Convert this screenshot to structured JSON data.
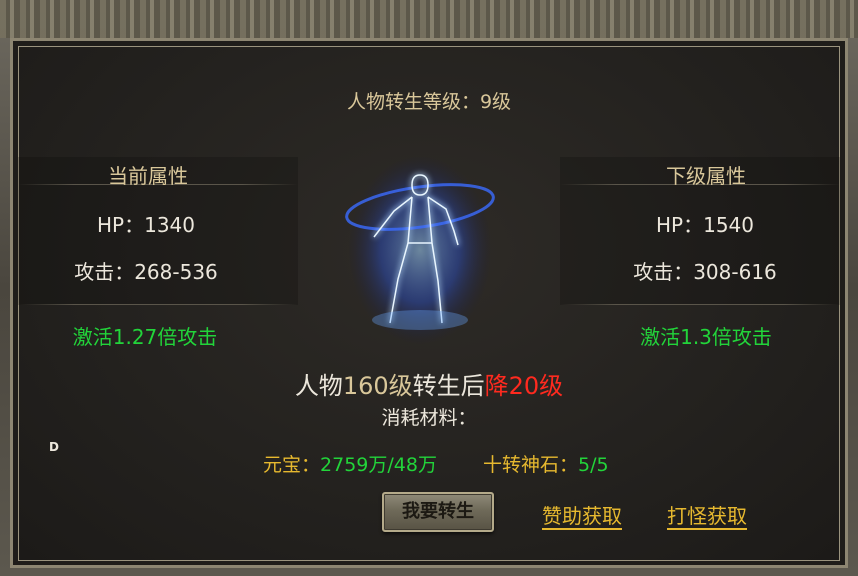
{
  "title": "人物转生等级：9级",
  "current": {
    "header": "当前属性",
    "hp": "HP：1340",
    "attack": "攻击：268-536",
    "activation": "激活1.27倍攻击"
  },
  "next": {
    "header": "下级属性",
    "hp": "HP：1540",
    "attack": "攻击：308-616",
    "activation": "激活1.3倍攻击"
  },
  "notice": {
    "prefix": "人物",
    "level": "160级",
    "middle": "转生后",
    "penalty": "降20级"
  },
  "materials_label": "消耗材料：",
  "materials": [
    {
      "label": "元宝：",
      "value": "2759万/48万"
    },
    {
      "label": "十转神石：",
      "value": "5/5"
    }
  ],
  "side_letter": "D",
  "buttons": {
    "rebirth": "我要转生",
    "sponsor": "赞助获取",
    "monster": "打怪获取"
  },
  "colors": {
    "gold_text": "#d9c79a",
    "green_text": "#22d43a",
    "yellow_text": "#e7b92f",
    "red_text": "#ff2a1f"
  },
  "icons": {
    "character": "glowing-character-silhouette"
  }
}
